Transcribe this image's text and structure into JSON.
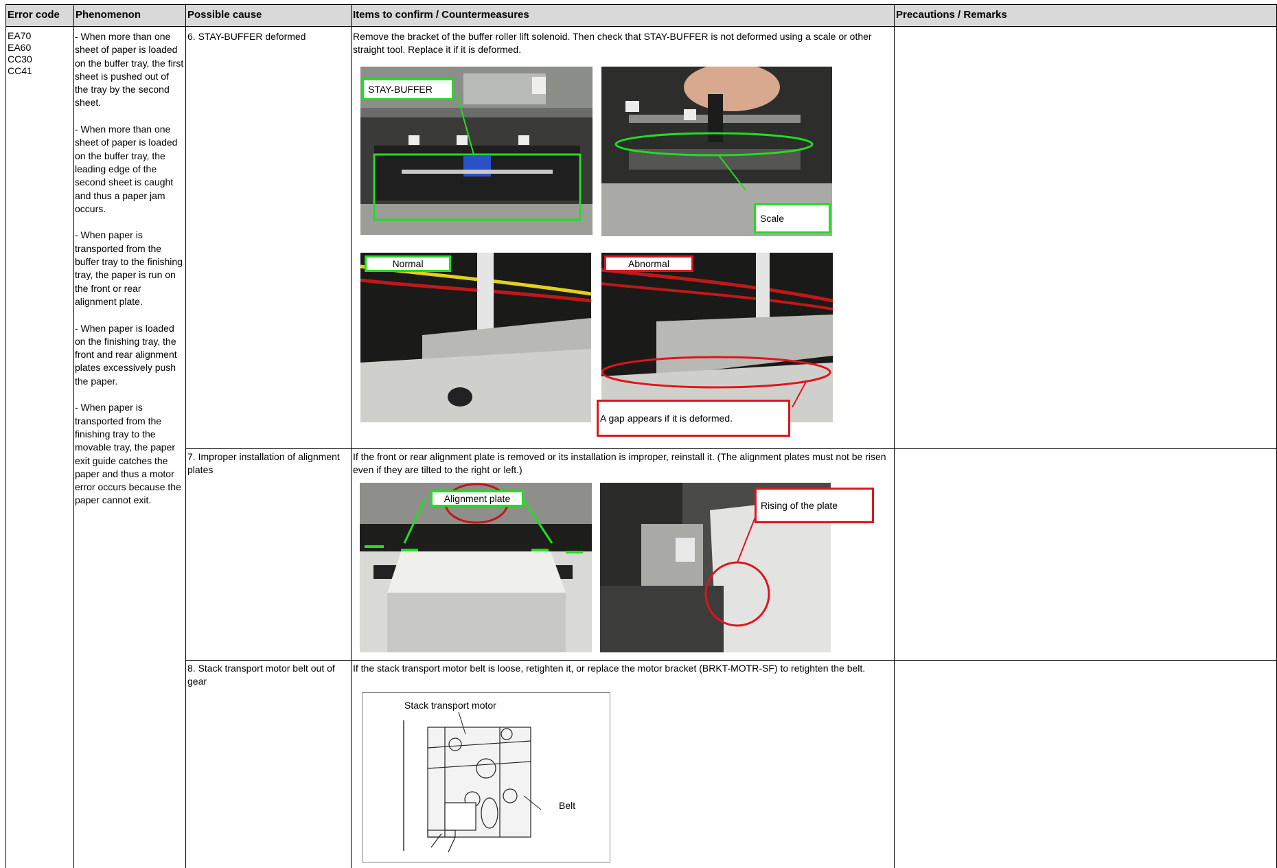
{
  "table": {
    "headers": {
      "error_code": "Error code",
      "phenomenon": "Phenomenon",
      "possible_cause": "Possible cause",
      "items": "Items to confirm / Countermeasures",
      "remarks": "Precautions / Remarks"
    },
    "error_codes": "EA70\nEA60\nCC30\nCC41",
    "phenomenon": "- When more than one sheet of paper is loaded on the buffer tray, the first sheet is pushed out of the tray by the second sheet.\n\n- When more than one sheet of paper is loaded on the buffer tray, the leading edge of the second sheet is caught and thus a paper jam occurs.\n\n- When paper is transported from the buffer tray to the finishing tray, the paper is run on the front or rear alignment plate.\n\n- When paper is loaded on the finishing tray, the front and rear alignment plates excessively push the paper.\n\n- When paper is transported from the finishing tray to the movable tray, the paper exit guide catches the paper and thus a motor error occurs because the paper cannot exit.",
    "rows": [
      {
        "cause": "6. STAY-BUFFER deformed",
        "countermeasure": "Remove the bracket of the buffer roller lift solenoid. Then check that STAY-BUFFER is not deformed using a scale or other straight tool. Replace it if it is deformed.",
        "remarks": ""
      },
      {
        "cause": "7. Improper installation of alignment plates",
        "countermeasure": "If the front or rear alignment plate is removed or its installation is improper, reinstall it. (The alignment plates must not be risen even if they are tilted to the right or left.)",
        "remarks": ""
      },
      {
        "cause": "8. Stack transport motor belt out of gear",
        "countermeasure": "If the stack transport motor belt is loose, retighten it, or replace the motor bracket (BRKT-MOTR-SF) to retighten the belt.",
        "remarks": ""
      }
    ]
  },
  "callouts": {
    "stay_buffer": "STAY-BUFFER",
    "scale": "Scale",
    "normal": "Normal",
    "abnormal": "Abnormal",
    "gap": "A gap appears if it is deformed.",
    "alignment_plate": "Alignment plate",
    "rising": "Rising of the plate",
    "stack_motor": "Stack transport motor",
    "belt": "Belt"
  },
  "colors": {
    "green_callout": "#22dd22",
    "red_callout": "#e0141e",
    "header_bg": "#d9d9d9"
  }
}
